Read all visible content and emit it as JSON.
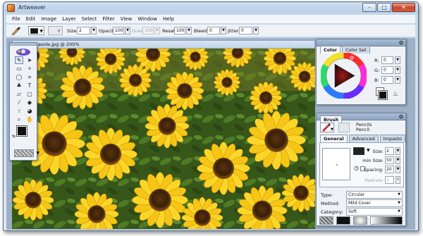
{
  "window": {
    "title": "Artweaver",
    "controls": [
      "–",
      "□",
      "✕"
    ]
  },
  "menu": [
    "File",
    "Edit",
    "Image",
    "Layer",
    "Select",
    "Filter",
    "View",
    "Window",
    "Help"
  ],
  "options": {
    "size_label": "Size:",
    "size_value": "2",
    "opacity_label": "Opacity:",
    "opacity_value": "100",
    "grain_label": "Grain:",
    "grain_value": "100",
    "resat_label": "Resat:",
    "resat_value": "100",
    "bleed_label": "Bleed:",
    "bleed_value": "0",
    "jitter_label": "Jitter:",
    "jitter_value": "0"
  },
  "document": {
    "title": "asole.jpg @ 200%"
  },
  "color_panel": {
    "tabs": [
      "Color",
      "Color Set"
    ],
    "r_label": "R:",
    "r_value": "0",
    "g_label": "G:",
    "g_value": "0",
    "b_label": "B:",
    "b_value": "0"
  },
  "brush_panel": {
    "title": "Brush",
    "category_name": "Pencils",
    "variant_name": "Pencil",
    "tabs": [
      "General",
      "Advanced",
      "Impasto"
    ],
    "size_label": "Size:",
    "size_value": "2",
    "min_size_label": "min Size:",
    "min_size_value": "50",
    "spacing_label": "Spacing:",
    "spacing_value": "20",
    "feature_label": "Feature:",
    "feature_value": "1",
    "type_label": "Type:",
    "type_value": "Circular",
    "method_label": "Method:",
    "method_value": "Mild Cover",
    "category_label": "Category:",
    "category_value": "Soft"
  },
  "colors": {
    "accent": "#8ba3c1",
    "foreground": "#111111",
    "background": "#ffffff"
  }
}
